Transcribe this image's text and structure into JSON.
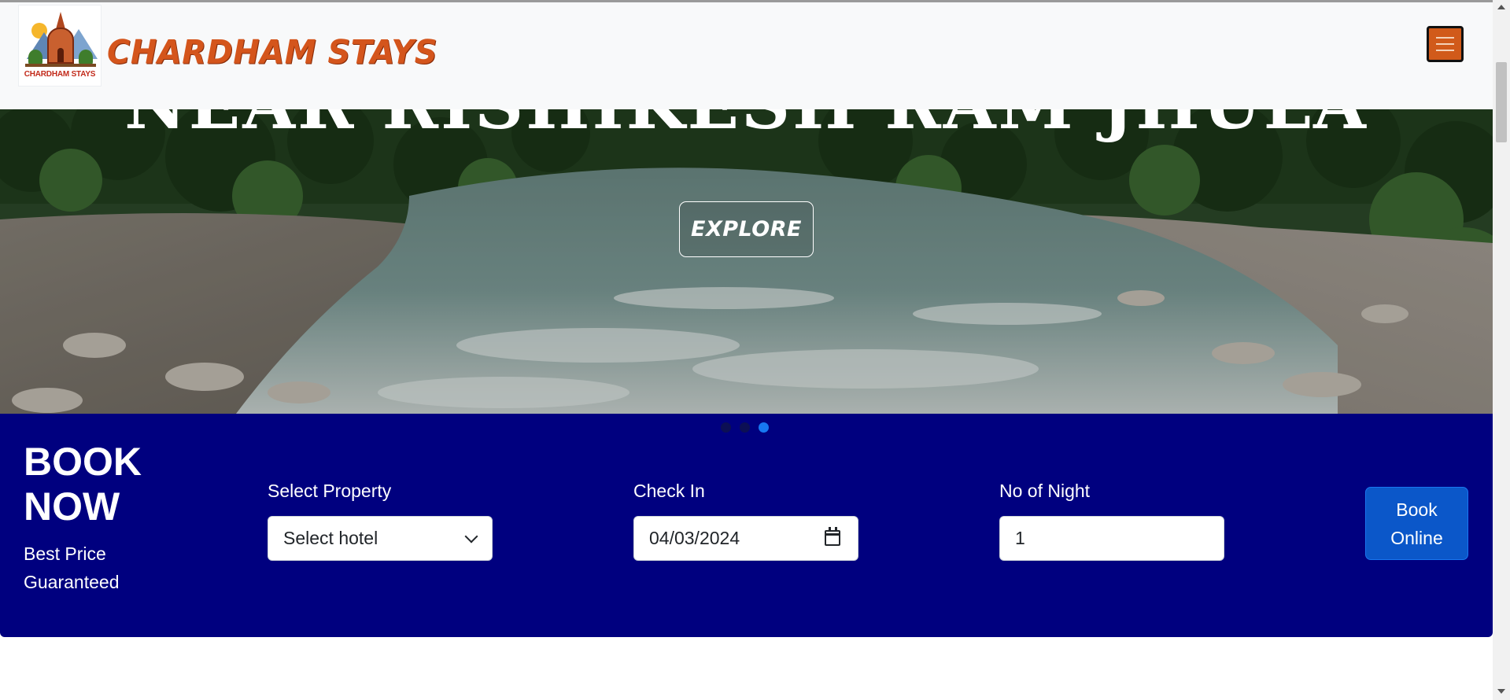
{
  "header": {
    "logo_caption": "CHARDHAM STAYS",
    "brand_name": "CHARDHAM STAYS",
    "menu_icon": "hamburger-menu-icon",
    "accent_color": "#d4551c"
  },
  "hero": {
    "title": "NEAR RISHIKESH RAM JHULA",
    "explore_label": "EXPLORE",
    "slides": 3,
    "active_slide": 3
  },
  "booking": {
    "title": "BOOK NOW",
    "subtitle": "Best Price Guaranteed",
    "property_label": "Select Property",
    "property_value": "Select hotel",
    "checkin_label": "Check In",
    "checkin_value": "04/03/2024",
    "nights_label": "No of Night",
    "nights_value": "1",
    "book_button": "Book Online",
    "background_color": "#00007f"
  }
}
